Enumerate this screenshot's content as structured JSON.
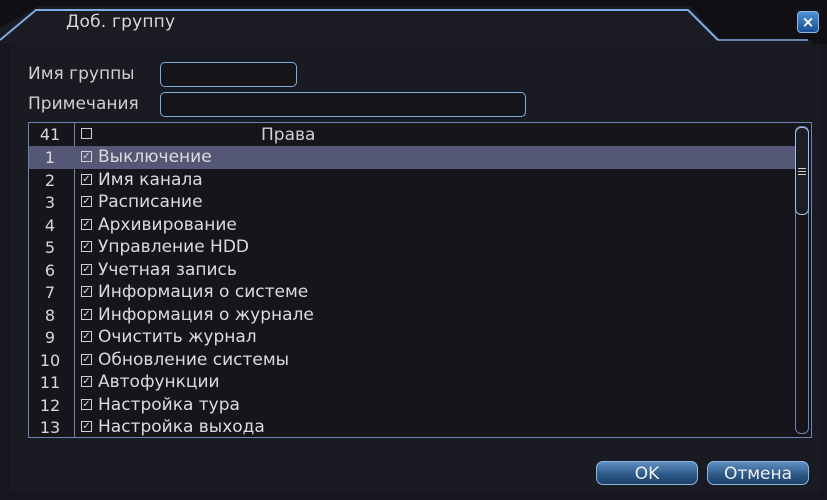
{
  "dialog": {
    "title": "Доб. группу",
    "close_icon": "close-icon"
  },
  "form": {
    "group_name_label": "Имя группы",
    "group_name_value": "",
    "notes_label": "Примечания",
    "notes_value": ""
  },
  "rights": {
    "count": "41",
    "header": "Права",
    "selected_index": 0,
    "rows": [
      {
        "n": "1",
        "label": "Выключение",
        "checked": true
      },
      {
        "n": "2",
        "label": "Имя канала",
        "checked": true
      },
      {
        "n": "3",
        "label": "Расписание",
        "checked": true
      },
      {
        "n": "4",
        "label": "Архивирование",
        "checked": true
      },
      {
        "n": "5",
        "label": "Управление HDD",
        "checked": true
      },
      {
        "n": "6",
        "label": "Учетная запись",
        "checked": true
      },
      {
        "n": "7",
        "label": "Информация о системе",
        "checked": true
      },
      {
        "n": "8",
        "label": "Информация о журнале",
        "checked": true
      },
      {
        "n": "9",
        "label": "Очистить журнал",
        "checked": true
      },
      {
        "n": "10",
        "label": "Обновление системы",
        "checked": true
      },
      {
        "n": "11",
        "label": "Автофункции",
        "checked": true
      },
      {
        "n": "12",
        "label": "Настройка тура",
        "checked": true
      },
      {
        "n": "13",
        "label": "Настройка выхода",
        "checked": true
      }
    ]
  },
  "buttons": {
    "ok": "OK",
    "cancel": "Отмена"
  },
  "colors": {
    "accent": "#7eaee0",
    "selection": "#545776"
  }
}
